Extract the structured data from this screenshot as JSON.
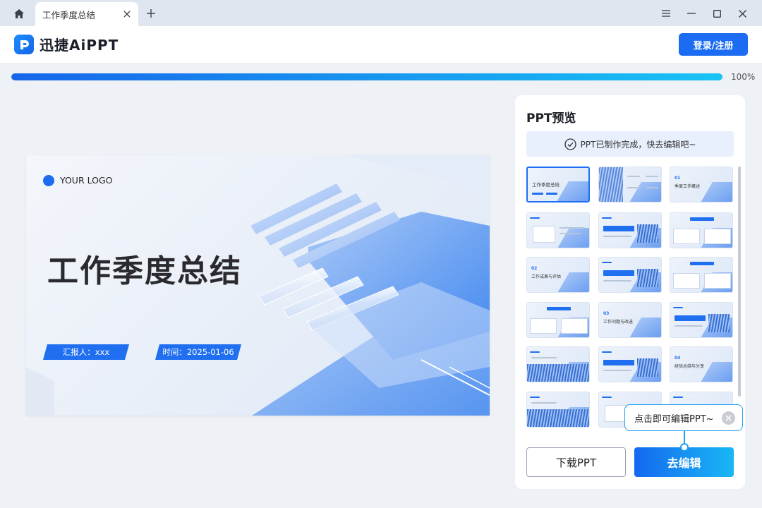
{
  "tab": {
    "title": "工作季度总结"
  },
  "header": {
    "logo_text": "迅捷AiPPT",
    "login_label": "登录/注册"
  },
  "progress": {
    "value": 1.0,
    "label": "100%"
  },
  "slide": {
    "logo_text": "YOUR LOGO",
    "title": "工作季度总结",
    "reporter": "汇报人：xxx",
    "date": "时间：2025-01-06"
  },
  "panel": {
    "title": "PPT预览",
    "notice": "PPT已制作完成，快去编辑吧~",
    "thumbnails": [
      {
        "label": "工作季度总结",
        "num": "",
        "kind": "cover"
      },
      {
        "label": "",
        "num": "",
        "kind": "toc"
      },
      {
        "label": "季度工作概述",
        "num": "01",
        "kind": "section"
      },
      {
        "label": "",
        "num": "",
        "kind": "content-a"
      },
      {
        "label": "",
        "num": "",
        "kind": "content-b"
      },
      {
        "label": "",
        "num": "",
        "kind": "content-c"
      },
      {
        "label": "工作成果与评估",
        "num": "02",
        "kind": "section"
      },
      {
        "label": "",
        "num": "",
        "kind": "content-b"
      },
      {
        "label": "",
        "num": "",
        "kind": "content-c"
      },
      {
        "label": "",
        "num": "",
        "kind": "content-c"
      },
      {
        "label": "工作问题与改进",
        "num": "03",
        "kind": "section"
      },
      {
        "label": "",
        "num": "",
        "kind": "content-b"
      },
      {
        "label": "",
        "num": "",
        "kind": "content-img"
      },
      {
        "label": "",
        "num": "",
        "kind": "content-b"
      },
      {
        "label": "经验总结与分享",
        "num": "04",
        "kind": "section"
      },
      {
        "label": "",
        "num": "",
        "kind": "content-img"
      },
      {
        "label": "",
        "num": "",
        "kind": "content-a"
      },
      {
        "label": "",
        "num": "",
        "kind": "content-a"
      }
    ]
  },
  "tooltip": {
    "text": "点击即可编辑PPT~"
  },
  "actions": {
    "download_label": "下载PPT",
    "edit_label": "去编辑"
  },
  "colors": {
    "accent": "#1b6cf2",
    "gradient_end": "#19c3f4"
  }
}
